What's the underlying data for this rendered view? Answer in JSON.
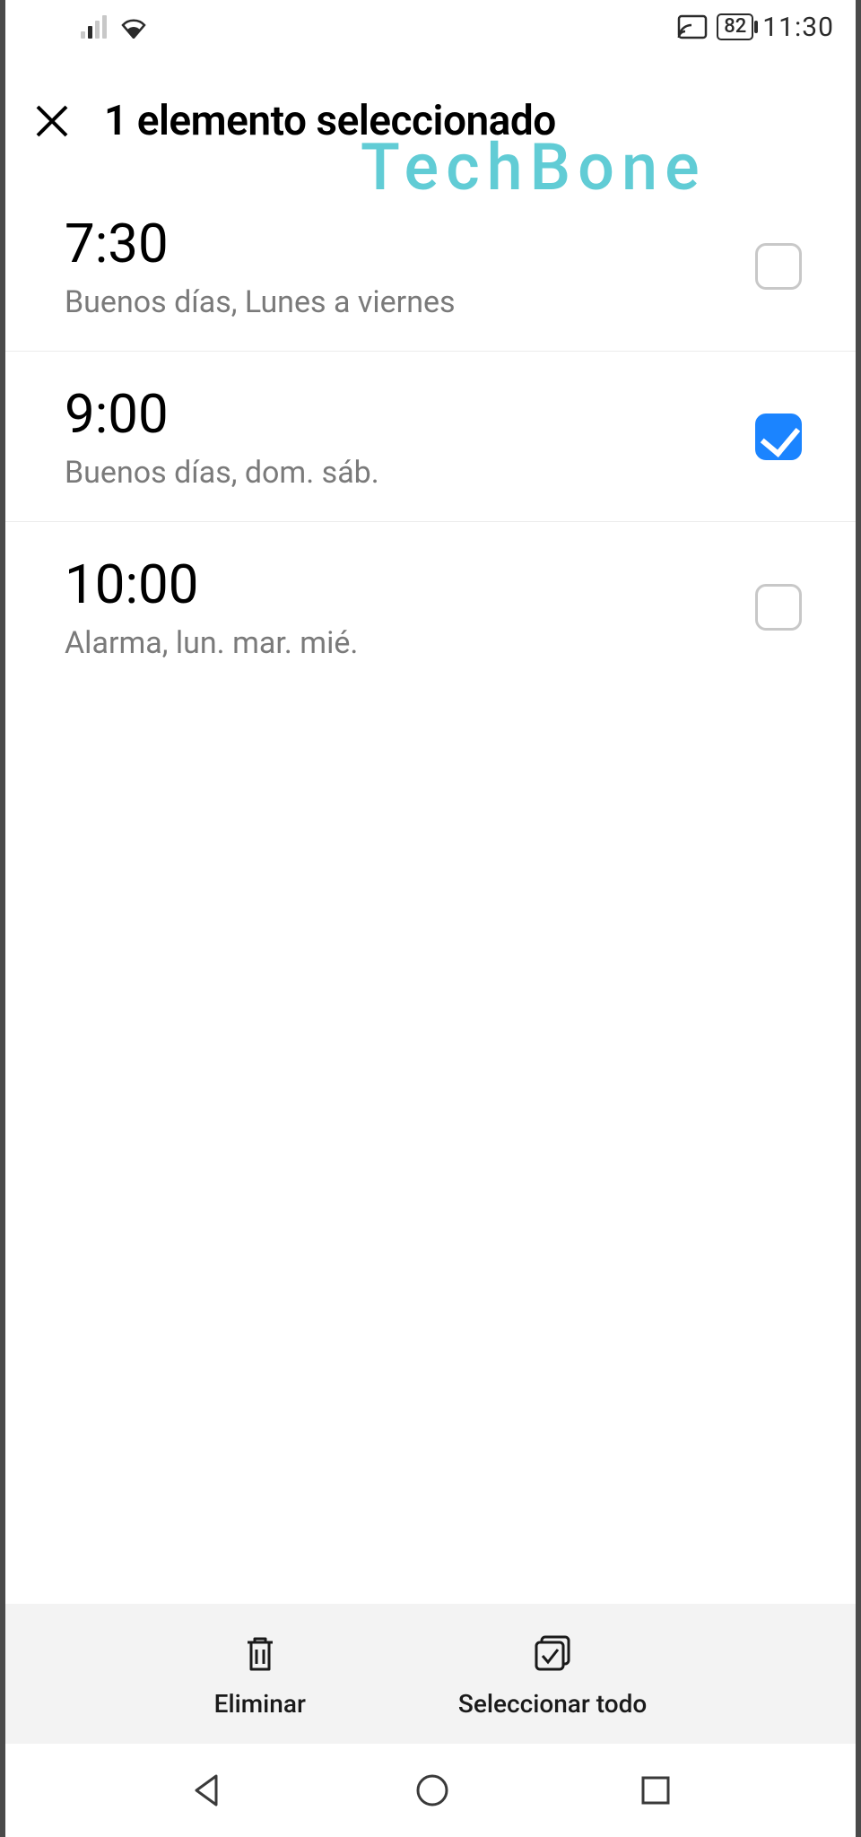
{
  "statusbar": {
    "battery": "82",
    "clock": "11:30"
  },
  "header": {
    "title": "1 elemento seleccionado"
  },
  "watermark": "TechBone",
  "alarms": [
    {
      "time": "7:30",
      "sub": "Buenos días, Lunes a viernes",
      "checked": false
    },
    {
      "time": "9:00",
      "sub": "Buenos días, dom. sáb.",
      "checked": true
    },
    {
      "time": "10:00",
      "sub": "Alarma, lun. mar. mié.",
      "checked": false
    }
  ],
  "actions": {
    "delete": "Eliminar",
    "select_all": "Seleccionar todo"
  }
}
